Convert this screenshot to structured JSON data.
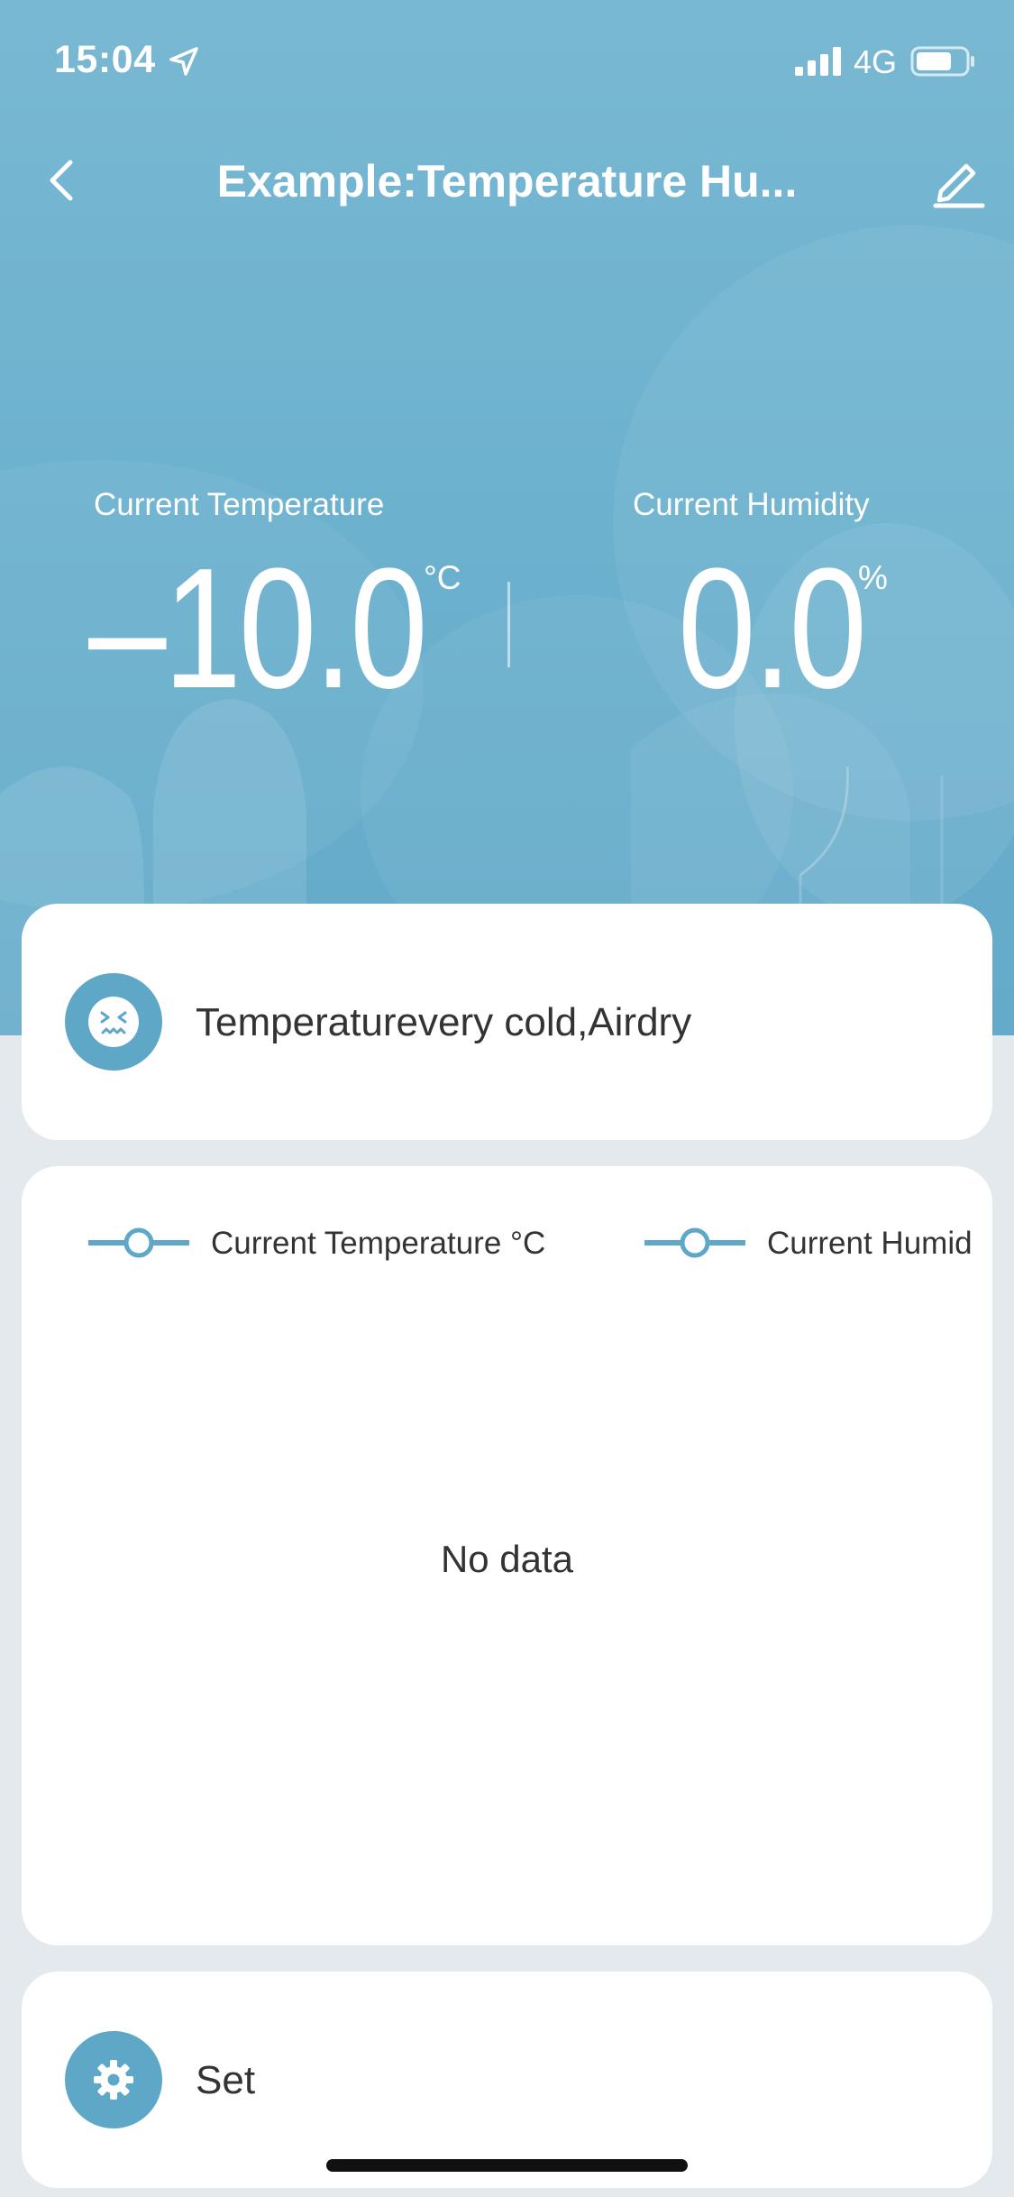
{
  "status_bar": {
    "time": "15:04",
    "network": "4G",
    "icons": [
      "location-arrow-icon",
      "signal-icon",
      "battery-icon"
    ]
  },
  "header": {
    "title": "Example:Temperature Hu...",
    "back_icon": "chevron-left-icon",
    "edit_icon": "pencil-icon"
  },
  "readings": {
    "temperature_label": "Current Temperature",
    "temperature_value": "–10.0",
    "temperature_unit": "°C",
    "humidity_label": "Current Humidity",
    "humidity_value": "0.0",
    "humidity_unit": "%"
  },
  "status_card": {
    "icon": "cold-face-icon",
    "text": "Temperaturevery cold,Airdry"
  },
  "chart_card": {
    "legend": [
      {
        "label": "Current Temperature °C"
      },
      {
        "label": "Current Humid"
      }
    ],
    "empty_text": "No data"
  },
  "settings_card": {
    "icon": "gear-icon",
    "label": "Set"
  },
  "colors": {
    "accent": "#5ea7c7",
    "hero_top": "#79b8d2",
    "hero_bottom": "#64aac9",
    "page_background": "#e3e9ed"
  }
}
